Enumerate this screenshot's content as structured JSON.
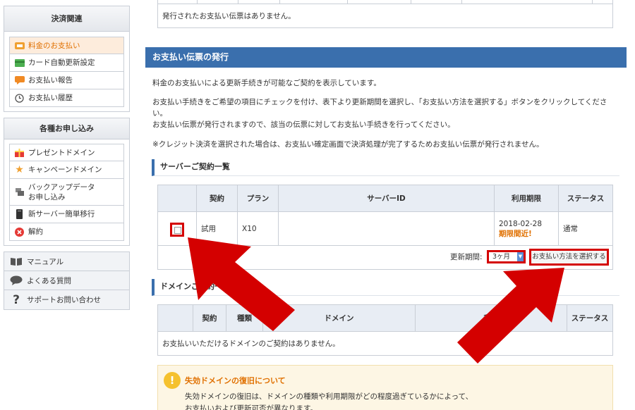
{
  "sidebar": {
    "payments": {
      "title": "決済関連",
      "items": [
        {
          "label": "料金のお支払い",
          "icon": "coin-icon",
          "active": true
        },
        {
          "label": "カード自動更新設定",
          "icon": "credit-card-icon"
        },
        {
          "label": "お支払い報告",
          "icon": "speech-bubble-icon"
        },
        {
          "label": "お支払い履歴",
          "icon": "clock-icon"
        }
      ]
    },
    "applications": {
      "title": "各種お申し込み",
      "items": [
        {
          "label": "プレゼントドメイン",
          "icon": "gift-icon"
        },
        {
          "label": "キャンペーンドメイン",
          "icon": "star-icon"
        },
        {
          "label": "バックアップデータ",
          "label2": "お申し込み",
          "icon": "backup-icon"
        },
        {
          "label": "新サーバー簡単移行",
          "icon": "server-icon"
        },
        {
          "label": "解約",
          "icon": "cancel-icon"
        }
      ]
    },
    "support": [
      {
        "label": "マニュアル",
        "icon": "book-icon"
      },
      {
        "label": "よくある質問",
        "icon": "chat-icon"
      },
      {
        "label": "サポートお問い合わせ",
        "icon": "question-icon"
      }
    ]
  },
  "main": {
    "top_message": "発行されたお支払い伝票はありません。",
    "section_title": "お支払い伝票の発行",
    "paragraphs": {
      "p1": "料金のお支払いによる更新手続きが可能なご契約を表示しています。",
      "p2a": "お支払い手続きをご希望の項目にチェックを付け、表下より更新期間を選択し、「お支払い方法を選択する」ボタンをクリックしてくださ",
      "p2b": "い。",
      "p2c": "お支払い伝票が発行されますので、該当の伝票に対してお支払い手続きを行ってください。",
      "p3": "※クレジット決済を選択された場合は、お支払い確定画面で決済処理が完了するためお支払い伝票が発行されません。"
    },
    "server": {
      "heading": "サーバーご契約一覧",
      "columns": [
        "契約",
        "プラン",
        "サーバーID",
        "利用期限",
        "ステータス"
      ],
      "row": {
        "contract": "試用",
        "plan": "X10",
        "server_id": "",
        "expiry": "2018-02-28",
        "expiry_note": "期限間近!",
        "status": "通常"
      },
      "period_label": "更新期間:",
      "period_value": "3ヶ月",
      "select_button": "お支払い方法を選択する"
    },
    "domain": {
      "heading": "ドメインご契約一覧",
      "columns": [
        "契約",
        "種類",
        "ドメイン",
        "利用",
        "ステータス"
      ],
      "empty_message": "お支払いいただけるドメインのご契約はありません。"
    },
    "notice": {
      "title": "失効ドメインの復旧について",
      "line1": "失効ドメインの復旧は、ドメインの種類や利用期限がどの程度過ぎているかによって、",
      "line2": "お支払いおよび更新可否が異なります。"
    }
  },
  "colors": {
    "accent": "#3a6fad",
    "highlight": "#d40000",
    "active_bg": "#fdecdc",
    "warning": "#e07000"
  }
}
